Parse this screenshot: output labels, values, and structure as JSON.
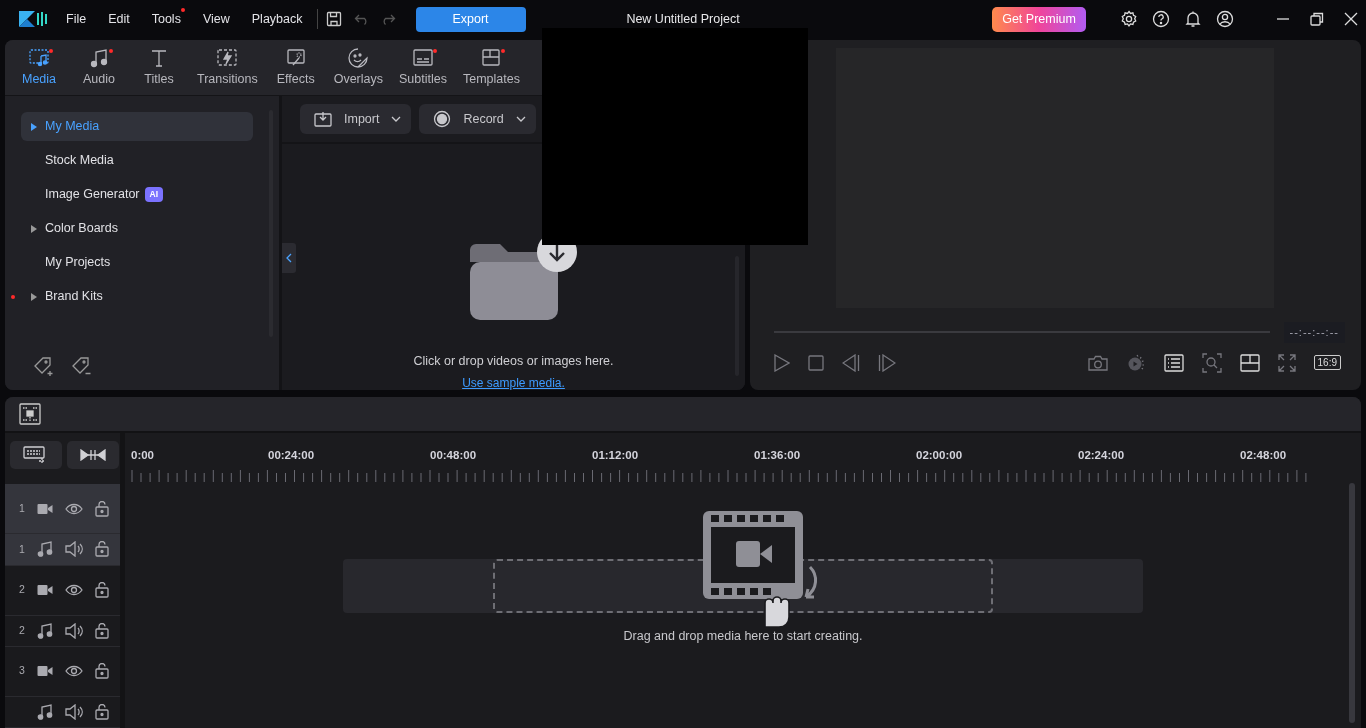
{
  "titlebar": {
    "menu": [
      {
        "label": "File",
        "dot": false
      },
      {
        "label": "Edit",
        "dot": false
      },
      {
        "label": "Tools",
        "dot": true
      },
      {
        "label": "View",
        "dot": false
      },
      {
        "label": "Playback",
        "dot": false
      }
    ],
    "export": "Export",
    "title": "New Untitled Project",
    "premium": "Get Premium"
  },
  "tabs": [
    {
      "label": "Media",
      "selected": true,
      "dot": true
    },
    {
      "label": "Audio",
      "selected": false,
      "dot": true
    },
    {
      "label": "Titles",
      "selected": false,
      "dot": false
    },
    {
      "label": "Transitions",
      "selected": false,
      "dot": false
    },
    {
      "label": "Effects",
      "selected": false,
      "dot": false
    },
    {
      "label": "Overlays",
      "selected": false,
      "dot": false
    },
    {
      "label": "Subtitles",
      "selected": false,
      "dot": true
    },
    {
      "label": "Templates",
      "selected": false,
      "dot": true
    }
  ],
  "sidebar": {
    "items": [
      {
        "label": "My Media",
        "selected": true,
        "expandable": true,
        "dot": false
      },
      {
        "label": "Stock Media",
        "selected": false,
        "expandable": false,
        "dot": false
      },
      {
        "label": "Image Generator",
        "selected": false,
        "expandable": false,
        "dot": false,
        "badge": "AI"
      },
      {
        "label": "Color Boards",
        "selected": false,
        "expandable": true,
        "dot": false
      },
      {
        "label": "My Projects",
        "selected": false,
        "expandable": false,
        "dot": false
      },
      {
        "label": "Brand Kits",
        "selected": false,
        "expandable": true,
        "dot": true
      }
    ]
  },
  "media": {
    "import": "Import",
    "record": "Record",
    "empty_text": "Click or drop videos or images here.",
    "sample_link": "Use sample media."
  },
  "preview": {
    "timecode": "--:--:--:--",
    "aspect": "16:9"
  },
  "timeline": {
    "ruler": [
      "0:00",
      "00:24:00",
      "00:48:00",
      "01:12:00",
      "01:36:00",
      "02:00:00",
      "02:24:00",
      "02:48:00"
    ],
    "tracks": [
      {
        "number": "1",
        "kind": "video",
        "selected": true
      },
      {
        "number": "1",
        "kind": "audio",
        "selected": true
      },
      {
        "number": "2",
        "kind": "video",
        "selected": false
      },
      {
        "number": "2",
        "kind": "audio",
        "selected": false
      },
      {
        "number": "3",
        "kind": "video",
        "selected": false
      },
      {
        "kind": "audio",
        "selected": false
      }
    ],
    "drop_text": "Drag and drop media here to start creating."
  }
}
